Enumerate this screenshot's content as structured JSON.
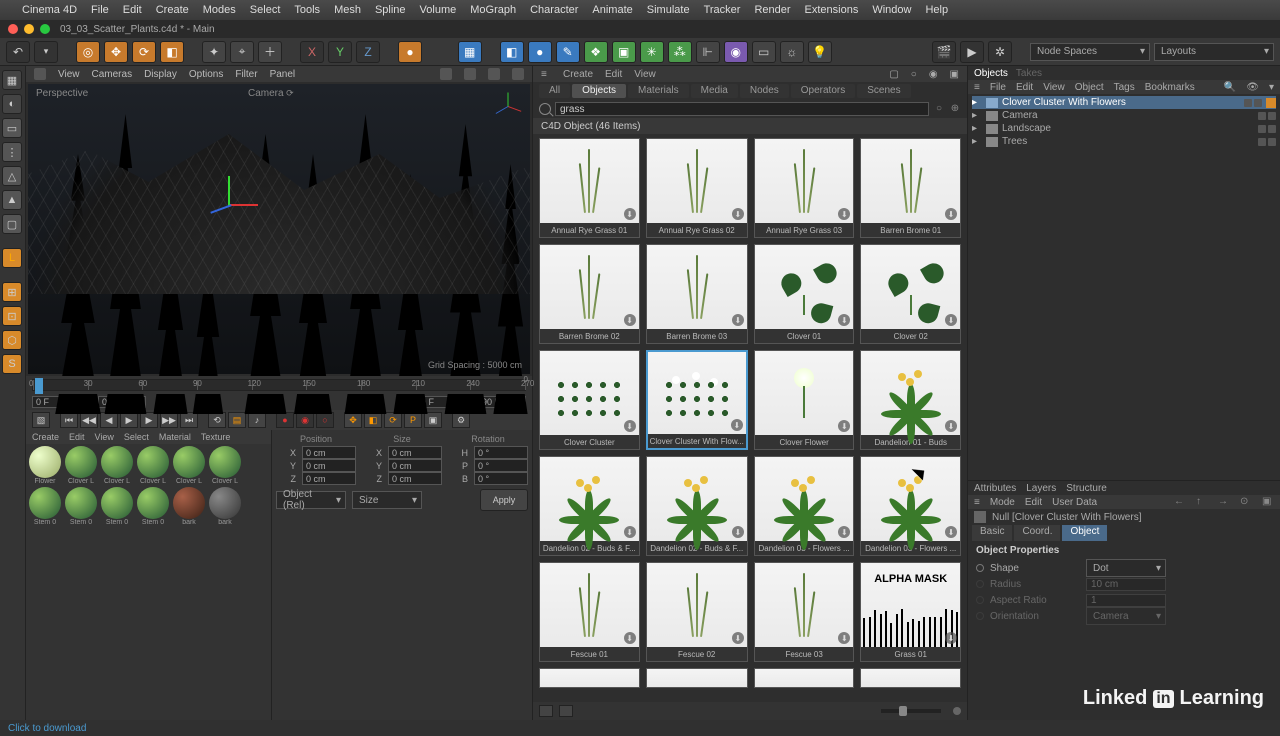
{
  "os_menu": [
    "Cinema 4D",
    "File",
    "Edit",
    "Create",
    "Modes",
    "Select",
    "Tools",
    "Mesh",
    "Spline",
    "Volume",
    "MoGraph",
    "Character",
    "Animate",
    "Simulate",
    "Tracker",
    "Render",
    "Extensions",
    "Window",
    "Help"
  ],
  "window_title": "03_03_Scatter_Plants.c4d * - Main",
  "top_dropdowns": {
    "node_spaces": "Node Spaces",
    "layouts": "Layouts"
  },
  "viewport": {
    "menubar": [
      "View",
      "Cameras",
      "Display",
      "Options",
      "Filter",
      "Panel"
    ],
    "label": "Perspective",
    "camera": "Camera",
    "grid_spacing": "Grid Spacing : 5000 cm"
  },
  "timeline": {
    "marks": [
      0,
      30,
      60,
      90,
      120,
      150,
      180,
      210,
      240,
      270
    ],
    "start": "0 F",
    "cur": "0 F",
    "end": "90 F",
    "end2": "90 F",
    "zero": "0"
  },
  "materials": {
    "menu": [
      "Create",
      "Edit",
      "View",
      "Select",
      "Material",
      "Texture"
    ],
    "items_row1": [
      "Flower",
      "Clover L",
      "Clover L",
      "Clover L",
      "Clover L",
      "Clover L"
    ],
    "items_row2": [
      "Stem 0",
      "Stem 0",
      "Stem 0",
      "Stem 0",
      "bark",
      "bark"
    ]
  },
  "coords": {
    "headers": [
      "Position",
      "Size",
      "Rotation"
    ],
    "rows": [
      {
        "a": "X",
        "p": "0 cm",
        "s": "X",
        "sv": "0 cm",
        "r": "H",
        "rv": "0 °"
      },
      {
        "a": "Y",
        "p": "0 cm",
        "s": "Y",
        "sv": "0 cm",
        "r": "P",
        "rv": "0 °"
      },
      {
        "a": "Z",
        "p": "0 cm",
        "s": "Z",
        "sv": "0 cm",
        "r": "B",
        "rv": "0 °"
      }
    ],
    "mode1": "Object (Rel)",
    "mode2": "Size",
    "apply": "Apply"
  },
  "assets": {
    "menu": [
      "Create",
      "Edit",
      "View"
    ],
    "tabs": [
      "All",
      "Objects",
      "Materials",
      "Media",
      "Nodes",
      "Operators",
      "Scenes"
    ],
    "active_tab": "Objects",
    "search": "grass",
    "header": "C4D Object (46 Items)",
    "items": [
      {
        "name": "Annual Rye Grass 01",
        "kind": "grass"
      },
      {
        "name": "Annual Rye Grass 02",
        "kind": "grass"
      },
      {
        "name": "Annual Rye Grass 03",
        "kind": "grass"
      },
      {
        "name": "Barren Brome 01",
        "kind": "grass"
      },
      {
        "name": "Barren Brome 02",
        "kind": "grass"
      },
      {
        "name": "Barren Brome 03",
        "kind": "grass"
      },
      {
        "name": "Clover 01",
        "kind": "clover"
      },
      {
        "name": "Clover 02",
        "kind": "clover"
      },
      {
        "name": "Clover Cluster",
        "kind": "cluster"
      },
      {
        "name": "Clover Cluster With Flow...",
        "kind": "clusterflower",
        "selected": true
      },
      {
        "name": "Clover Flower",
        "kind": "flower"
      },
      {
        "name": "Dandelion 01 - Buds",
        "kind": "dandelion"
      },
      {
        "name": "Dandelion 02 - Buds & F...",
        "kind": "dandelion"
      },
      {
        "name": "Dandelion 02 - Buds & F...",
        "kind": "dandelion"
      },
      {
        "name": "Dandelion 03 - Flowers ...",
        "kind": "dandelion"
      },
      {
        "name": "Dandelion 03 - Flowers ...",
        "kind": "dandelion"
      },
      {
        "name": "Fescue 01",
        "kind": "grass"
      },
      {
        "name": "Fescue 02",
        "kind": "grass"
      },
      {
        "name": "Fescue 03",
        "kind": "grass"
      },
      {
        "name": "Grass 01",
        "kind": "alpha",
        "alpha_label": "ALPHA MASK"
      },
      {
        "name": "",
        "kind": "partial"
      },
      {
        "name": "",
        "kind": "partial"
      },
      {
        "name": "",
        "kind": "partial"
      },
      {
        "name": "",
        "kind": "partial"
      }
    ]
  },
  "objects_panel": {
    "tabs": [
      "Objects",
      "Takes"
    ],
    "menu": [
      "File",
      "Edit",
      "View",
      "Object",
      "Tags",
      "Bookmarks"
    ],
    "tree": [
      {
        "name": "Clover Cluster With Flowers",
        "sel": true,
        "tag": true
      },
      {
        "name": "Camera"
      },
      {
        "name": "Landscape"
      },
      {
        "name": "Trees"
      }
    ]
  },
  "attributes": {
    "tabs": [
      "Attributes",
      "Layers",
      "Structure"
    ],
    "menu": [
      "Mode",
      "Edit",
      "User Data"
    ],
    "obj_label": "Null [Clover Cluster With Flowers]",
    "prop_tabs": [
      "Basic",
      "Coord.",
      "Object"
    ],
    "section": "Object Properties",
    "rows": [
      {
        "label": "Shape",
        "value": "Dot",
        "enabled": true
      },
      {
        "label": "Radius",
        "value": "10 cm",
        "enabled": false
      },
      {
        "label": "Aspect Ratio",
        "value": "1",
        "enabled": false
      },
      {
        "label": "Orientation",
        "value": "Camera",
        "enabled": false
      }
    ]
  },
  "status": "Click to download",
  "watermark": {
    "a": "Linked",
    "b": "in",
    "c": "Learning"
  }
}
